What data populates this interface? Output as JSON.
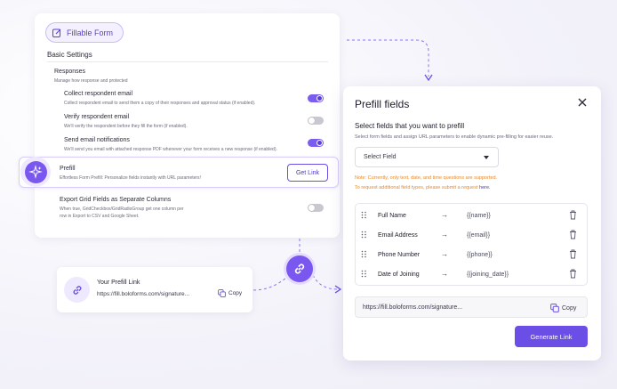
{
  "form_chip": {
    "label": "Fillable Form"
  },
  "settings": {
    "section_title": "Basic Settings",
    "responses_title": "Responses",
    "responses_subtitle": "Manage how response and protected",
    "rows": [
      {
        "title": "Collect respondent email",
        "desc": "Collect respondent email to send them a copy of their responses and approval status (if enabled).",
        "enabled": true
      },
      {
        "title": "Verify respondent email",
        "desc": "We'll verify the respondent before they fill the form (if enabled).",
        "enabled": false
      },
      {
        "title": "Send email notifications",
        "desc": "We'll send you email with attached response PDF whenever your form receives a new response (if enabled).",
        "enabled": true
      }
    ],
    "prefill": {
      "title": "Prefill",
      "desc": "Effortless Form Prefill: Personalize fields instantly with URL parameters!",
      "button": "Get Link"
    },
    "export": {
      "title": "Export Grid Fields as Separate Columns",
      "desc_line1": "When true, GridCheckbox/GridRadioGroup get one column per",
      "desc_line2": "row in Export to CSV and Google Sheet.",
      "enabled": false
    }
  },
  "link_card": {
    "title": "Your Prefill Link",
    "url": "https://fill.boloforms.com/signature...",
    "copy": "Copy"
  },
  "modal": {
    "title": "Prefill fields",
    "heading": "Select fields that you want to prefill",
    "subheading": "Select form fields and assign URL parameters to enable dynamic pre-filling for easier reuse.",
    "select_placeholder": "Select Field",
    "note1": "Note: Currently, only text, date, and time questions are supported.",
    "note2_text": "To request additional field types, please submit a request ",
    "note2_link": "here.",
    "fields": [
      {
        "name": "Full Name",
        "arrow": "→",
        "param": "{{name}}"
      },
      {
        "name": "Email Address",
        "arrow": "→",
        "param": "{{email}}"
      },
      {
        "name": "Phone Number",
        "arrow": "→",
        "param": "{{phone}}"
      },
      {
        "name": "Date of Joining",
        "arrow": "→",
        "param": "{{joining_date}}"
      }
    ],
    "url": "https://fill.boloforms.com/signature...",
    "copy": "Copy",
    "generate": "Generate Link"
  },
  "colors": {
    "accent": "#6a4ee6",
    "note": "#e58a2b",
    "toggle_on": "#7b5cf0",
    "toggle_off": "#c8c8d0"
  }
}
